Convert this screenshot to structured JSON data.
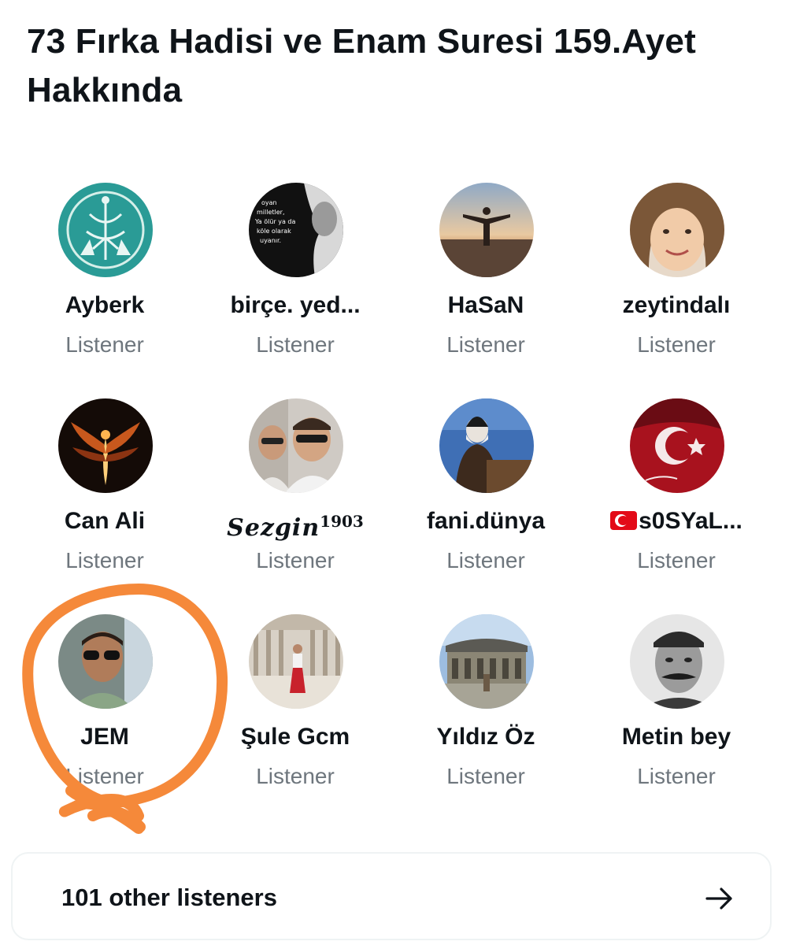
{
  "space": {
    "title": "73 Fırka Hadisi ve Enam Suresi 159.Ayet Hakkında"
  },
  "listeners": [
    {
      "name": "Ayberk",
      "role": "Listener",
      "avatar": "emblem-avatar"
    },
    {
      "name": "birçe. yed...",
      "role": "Listener",
      "avatar": "quote-poster-avatar",
      "avatar_text": [
        "oyan",
        "milletler,",
        "Ya ölür ya da",
        "köle olarak",
        "uyanır."
      ]
    },
    {
      "name": "HaSaN",
      "role": "Listener",
      "avatar": "sunset-man-avatar"
    },
    {
      "name": "zeytindalı",
      "role": "Listener",
      "avatar": "child-face-avatar"
    },
    {
      "name": "Can Ali",
      "role": "Listener",
      "avatar": "fire-phoenix-avatar"
    },
    {
      "name": "Sezgin",
      "name_sup": "1903",
      "role": "Listener",
      "avatar": "selfie-avatar"
    },
    {
      "name": "fani.dünya",
      "role": "Listener",
      "avatar": "speaker-podium-avatar"
    },
    {
      "name": "s0SYaL...",
      "role": "Listener",
      "avatar": "turkish-flag-avatar",
      "flag": true
    },
    {
      "name": "JEM",
      "role": "Listener",
      "avatar": "sunglasses-man-avatar"
    },
    {
      "name": "Şule Gcm",
      "role": "Listener",
      "avatar": "courtyard-woman-avatar"
    },
    {
      "name": "Yıldız Öz",
      "role": "Listener",
      "avatar": "building-avatar"
    },
    {
      "name": "Metin bey",
      "role": "Listener",
      "avatar": "mustache-man-avatar"
    }
  ],
  "more": {
    "label": "101 other listeners",
    "icon": "arrow-right-icon"
  },
  "colors": {
    "text": "#0f1419",
    "secondary": "#6e767d",
    "border": "#eff3f4",
    "annotation": "#f5893a"
  }
}
